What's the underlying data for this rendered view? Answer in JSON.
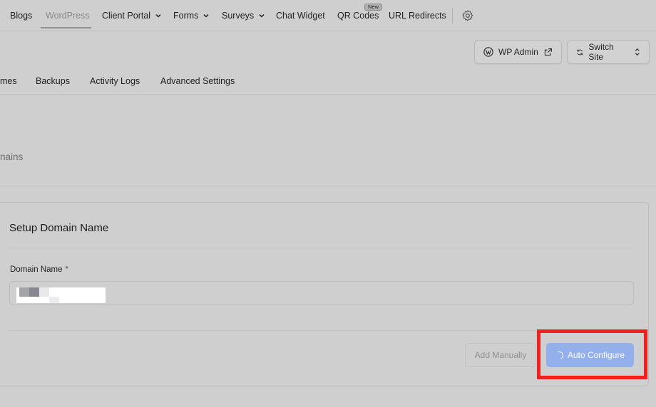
{
  "nav": {
    "items": [
      {
        "label": "Blogs"
      },
      {
        "label": "WordPress"
      },
      {
        "label": "Client Portal"
      },
      {
        "label": "Forms"
      },
      {
        "label": "Surveys"
      },
      {
        "label": "Chat Widget"
      },
      {
        "label": "QR Codes"
      },
      {
        "label": "URL Redirects"
      }
    ],
    "active": "WordPress",
    "new_badge": "New",
    "settings_icon": "gear-icon"
  },
  "header": {
    "wp_admin_label": "WP Admin",
    "switch_site_label": "Switch Site"
  },
  "subtabs": [
    "mes",
    "Backups",
    "Activity Logs",
    "Advanced Settings"
  ],
  "section": {
    "label": "nains"
  },
  "card": {
    "title": "Setup Domain Name",
    "field_label": "Domain Name",
    "required_mark": "*",
    "domain_value": "",
    "add_manually_label": "Add Manually",
    "auto_configure_label": "Auto Configure"
  },
  "colors": {
    "overlay_background": "#cfcfcf",
    "primary_button": "#93b0ec",
    "highlight": "#f21f1f"
  }
}
